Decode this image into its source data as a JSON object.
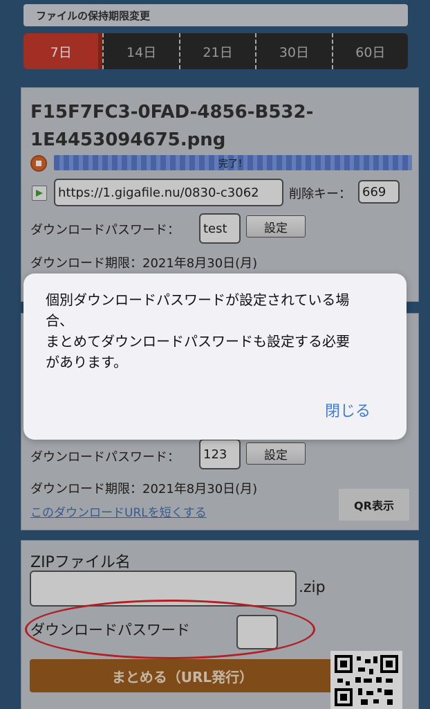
{
  "retention": {
    "title": "ファイルの保持期限変更",
    "options": [
      "7日",
      "14日",
      "21日",
      "30日",
      "60日"
    ],
    "selected": "7日"
  },
  "file1": {
    "name_line1": "F15F7FC3-0FAD-4856-B532-",
    "name_line2": "1E4453094675.png",
    "progress_label": "完了！",
    "url": "https://1.gigafile.nu/0830-c3062",
    "delete_key_label": "削除キー：",
    "delete_key_value": "669",
    "password_label": "ダウンロードパスワード：",
    "password_value": "test",
    "set_button": "設定",
    "expiry": "ダウンロード期限：2021年8月30日(月)"
  },
  "file2": {
    "password_label": "ダウンロードパスワード：",
    "password_value": "123",
    "set_button": "設定",
    "expiry": "ダウンロード期限：2021年8月30日(月)",
    "shorten_link": "このダウンロードURLを短くする",
    "qr_button": "QR表示"
  },
  "zip": {
    "name_label": "ZIPファイル名",
    "extension": ".zip",
    "password_label": "ダウンロードパスワード",
    "collect_button": "まとめる（URL発行）"
  },
  "dialog": {
    "line1": "個別ダウンロードパスワードが設定されている場",
    "line2": "合、",
    "line3": "まとめてダウンロードパスワードも設定する必要",
    "line4": "があります。",
    "close": "閉じる"
  }
}
